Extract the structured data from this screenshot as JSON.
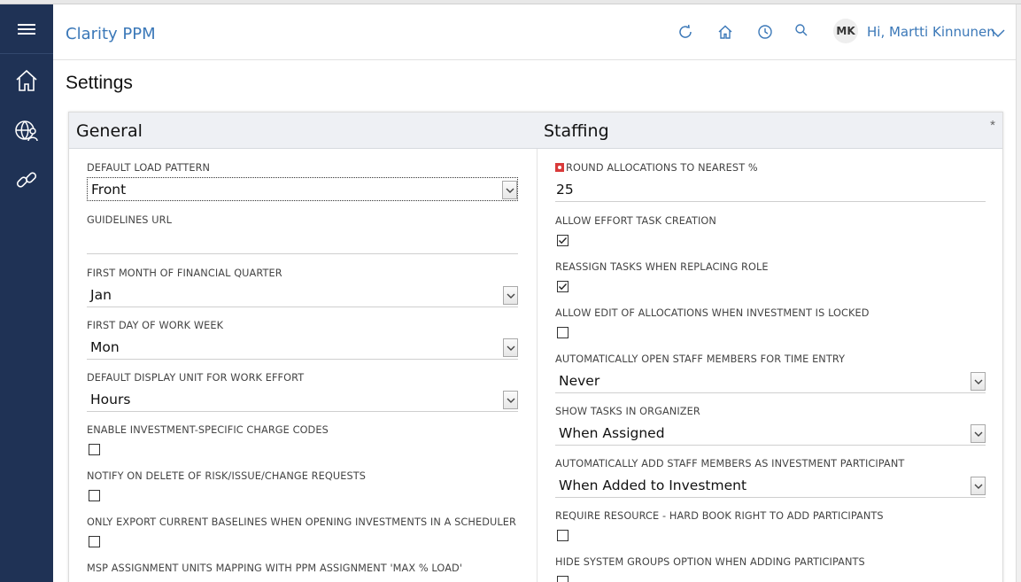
{
  "app": {
    "title": "Clarity PPM"
  },
  "header": {
    "avatar_initials": "MK",
    "greeting": "Hi, Martti Kinnunen",
    "icons": [
      "refresh-icon",
      "home-icon",
      "recent-clock-icon",
      "search-icon",
      "chevron-down-icon"
    ]
  },
  "leftnav": {
    "icons": [
      "menu-icon",
      "home-icon",
      "globe-people-icon",
      "link-icon"
    ]
  },
  "page": {
    "title": "Settings"
  },
  "panel": {
    "corner": "*"
  },
  "general": {
    "title": "General",
    "default_load_pattern": {
      "label": "DEFAULT LOAD PATTERN",
      "value": "Front"
    },
    "guidelines_url": {
      "label": "GUIDELINES URL",
      "value": ""
    },
    "first_month": {
      "label": "FIRST MONTH OF FINANCIAL QUARTER",
      "value": "Jan"
    },
    "first_day": {
      "label": "FIRST DAY OF WORK WEEK",
      "value": "Mon"
    },
    "display_unit": {
      "label": "DEFAULT DISPLAY UNIT FOR WORK EFFORT",
      "value": "Hours"
    },
    "charge_codes": {
      "label": "ENABLE INVESTMENT-SPECIFIC CHARGE CODES",
      "checked": false
    },
    "notify_delete": {
      "label": "NOTIFY ON DELETE OF RISK/ISSUE/CHANGE REQUESTS",
      "checked": false
    },
    "export_baselines": {
      "label": "ONLY EXPORT CURRENT BASELINES WHEN OPENING INVESTMENTS IN A SCHEDULER",
      "checked": false
    },
    "msp_mapping": {
      "label": "MSP ASSIGNMENT UNITS MAPPING WITH PPM ASSIGNMENT 'MAX % LOAD'"
    }
  },
  "staffing": {
    "title": "Staffing",
    "round_allocations": {
      "label": "ROUND ALLOCATIONS TO NEAREST %",
      "value": "25",
      "required": true
    },
    "effort_task": {
      "label": "ALLOW EFFORT TASK CREATION",
      "checked": true
    },
    "reassign_tasks": {
      "label": "REASSIGN TASKS WHEN REPLACING ROLE",
      "checked": true
    },
    "edit_allocations": {
      "label": "ALLOW EDIT OF ALLOCATIONS WHEN INVESTMENT IS LOCKED",
      "checked": false
    },
    "open_staff": {
      "label": "AUTOMATICALLY OPEN STAFF MEMBERS FOR TIME ENTRY",
      "value": "Never"
    },
    "show_tasks": {
      "label": "SHOW TASKS IN ORGANIZER",
      "value": "When Assigned"
    },
    "add_staff": {
      "label": "AUTOMATICALLY ADD STAFF MEMBERS AS INVESTMENT PARTICIPANT",
      "value": "When Added to Investment"
    },
    "require_hard_book": {
      "label": "REQUIRE RESOURCE - HARD BOOK RIGHT TO ADD PARTICIPANTS",
      "checked": false
    },
    "hide_groups": {
      "label": "HIDE SYSTEM GROUPS OPTION WHEN ADDING PARTICIPANTS",
      "checked": false
    }
  },
  "colors": {
    "nav_bg": "#1f3255",
    "accent": "#3b78b8",
    "panel_head_bg": "#eef0f4"
  }
}
